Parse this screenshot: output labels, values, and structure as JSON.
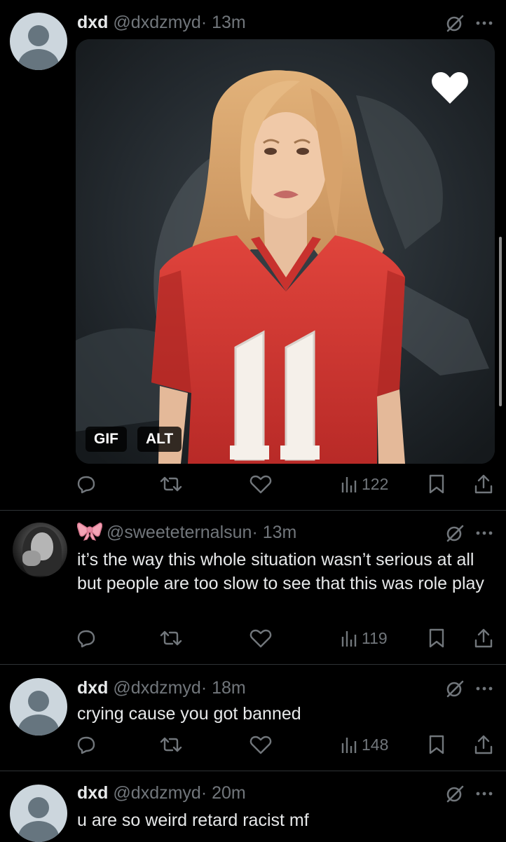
{
  "tweets": [
    {
      "name": "dxd",
      "handle": "@dxdzmyd",
      "time": "· 13m",
      "media": {
        "badges": [
          "GIF",
          "ALT"
        ],
        "jersey_number": "11",
        "liked_overlay_icon": "heart-icon"
      },
      "views": "122"
    },
    {
      "name_emoji": "🎀",
      "handle": "@sweeteternalsun",
      "time": "· 13m",
      "text": "it’s the way this whole situation wasn’t serious at all but people are too slow to see that this was role play",
      "views": "119"
    },
    {
      "name": "dxd",
      "handle": "@dxdzmyd",
      "time": "· 18m",
      "text": "crying cause you got banned",
      "views": "148"
    },
    {
      "name": "dxd",
      "handle": "@dxdzmyd",
      "time": "· 20m",
      "text": "u are so weird retard racist mf"
    }
  ],
  "icons": {
    "grok": "grok-icon",
    "more": "more-icon",
    "reply": "reply-icon",
    "retweet": "retweet-icon",
    "like": "like-icon",
    "views": "views-icon",
    "bookmark": "bookmark-icon",
    "share": "share-icon"
  },
  "colors": {
    "background": "#000000",
    "text": "#e7e9ea",
    "secondary": "#71767b",
    "divider": "#2f3336",
    "jersey": "#d83a33",
    "ribbon": "#f4a3b5"
  }
}
